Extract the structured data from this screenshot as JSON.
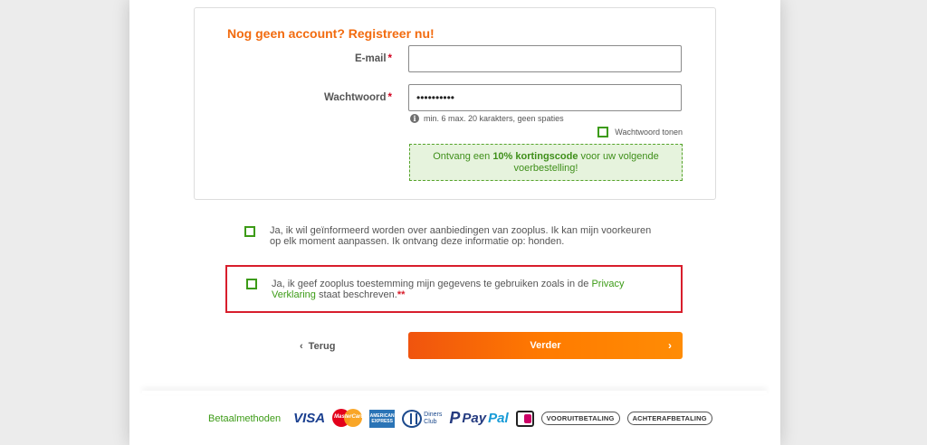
{
  "register": {
    "title": "Nog geen account? Registreer nu!",
    "email_label": "E-mail",
    "password_label": "Wachtwoord",
    "required_marker": "*",
    "email_value": "",
    "password_value": "••••••••••",
    "password_hint": "min. 6 max. 20 karakters, geen spaties",
    "show_password_label": "Wachtwoord tonen",
    "promo_pre": "Ontvang een ",
    "promo_bold": "10% kortingscode",
    "promo_post": " voor uw volgende voerbestelling!"
  },
  "newsletter": {
    "text": "Ja, ik wil geïnformeerd worden over aanbiedingen van zooplus. Ik kan mijn voorkeuren op elk moment aanpassen. Ik ontvang deze informatie op: honden."
  },
  "consent": {
    "text_pre": "Ja, ik geef zooplus toestemming mijn gegevens te gebruiken zoals in de ",
    "link": "Privacy Verklaring",
    "text_post": " staat beschreven.",
    "stars": "**"
  },
  "nav": {
    "back_label": "Terug",
    "next_label": "Verder"
  },
  "payment": {
    "title": "Betaalmethoden",
    "methods": [
      "VISA",
      "MasterCard",
      "American Express",
      "Diners Club",
      "PayPal",
      "iDEAL",
      "VOORUITBETALING",
      "ACHTERAFBETALING"
    ],
    "visa_text": "VISA",
    "mc_text": "MasterCard",
    "amex_text": "AMERICAN EXPRESS",
    "diners_text_1": "Diners",
    "diners_text_2": "Club",
    "paypal_1": "Pay",
    "paypal_2": "Pal",
    "badge_1": "VOORUITBETALING",
    "badge_2": "ACHTERAFBETALING"
  },
  "colors": {
    "accent_orange": "#f26b0f",
    "green": "#3c9b16",
    "error_red": "#d81e2c"
  }
}
